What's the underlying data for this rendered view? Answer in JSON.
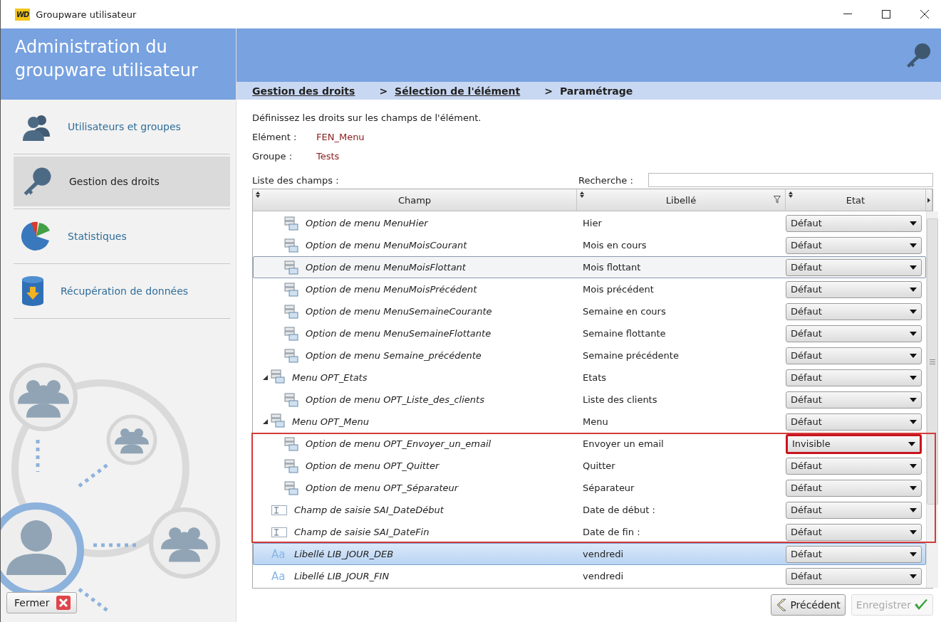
{
  "window": {
    "logo": "WD",
    "title": "Groupware utilisateur"
  },
  "sidebar": {
    "title_lines": [
      "Administration du",
      "groupware utilisateur"
    ],
    "items": [
      {
        "label": "Utilisateurs et groupes",
        "selected": false
      },
      {
        "label": "Gestion des droits",
        "selected": true
      },
      {
        "label": "Statistiques",
        "selected": false
      },
      {
        "label": "Récupération de données",
        "selected": false
      }
    ],
    "close_button": "Fermer"
  },
  "breadcrumb": [
    {
      "text": "Gestion des droits",
      "kind": "link"
    },
    {
      "text": ">",
      "kind": "separator"
    },
    {
      "text": "Sélection de l'élément",
      "kind": "link"
    },
    {
      "text": ">",
      "kind": "separator"
    },
    {
      "text": "Paramétrage",
      "kind": "current"
    }
  ],
  "intro": "Définissez les droits sur les champs de l'élément.",
  "fields": [
    {
      "label": "Elément :",
      "value": "FEN_Menu"
    },
    {
      "label": "Groupe :",
      "value": "Tests"
    }
  ],
  "list_label": "Liste des champs :",
  "search": {
    "label": "Recherche :"
  },
  "table": {
    "columns": [
      {
        "title": "Champ",
        "filter": false
      },
      {
        "title": "Libellé",
        "filter": true
      },
      {
        "title": "Etat",
        "filter": false
      }
    ],
    "rows": [
      {
        "kind": "menu-option",
        "name": "Option de menu MenuHier",
        "label": "Hier",
        "state": "Défaut",
        "selected": false,
        "focused": false,
        "highlighted": false,
        "state_marked": false
      },
      {
        "kind": "menu-option",
        "name": "Option de menu MenuMoisCourant",
        "label": "Mois en cours",
        "state": "Défaut",
        "selected": false,
        "focused": false,
        "highlighted": false,
        "state_marked": false
      },
      {
        "kind": "menu-option",
        "name": "Option de menu MenuMoisFlottant",
        "label": "Mois flottant",
        "state": "Défaut",
        "selected": false,
        "focused": true,
        "highlighted": false,
        "state_marked": false
      },
      {
        "kind": "menu-option",
        "name": "Option de menu MenuMoisPrécédent",
        "label": "Mois précédent",
        "state": "Défaut",
        "selected": false,
        "focused": false,
        "highlighted": false,
        "state_marked": false
      },
      {
        "kind": "menu-option",
        "name": "Option de menu MenuSemaineCourante",
        "label": "Semaine en cours",
        "state": "Défaut",
        "selected": false,
        "focused": false,
        "highlighted": false,
        "state_marked": false
      },
      {
        "kind": "menu-option",
        "name": "Option de menu MenuSemaineFlottante",
        "label": "Semaine flottante",
        "state": "Défaut",
        "selected": false,
        "focused": false,
        "highlighted": false,
        "state_marked": false
      },
      {
        "kind": "menu-option",
        "name": "Option de menu Semaine_précédente",
        "label": "Semaine précédente",
        "state": "Défaut",
        "selected": false,
        "focused": false,
        "highlighted": false,
        "state_marked": false
      },
      {
        "kind": "menu",
        "name": "Menu OPT_Etats",
        "label": "Etats",
        "state": "Défaut",
        "selected": false,
        "focused": false,
        "highlighted": false,
        "state_marked": false,
        "expanded": true,
        "children": [
          {
            "kind": "menu-option",
            "name": "Option de menu OPT_Liste_des_clients",
            "label": "Liste des clients",
            "state": "Défaut",
            "selected": false,
            "focused": false,
            "highlighted": false,
            "state_marked": false
          }
        ]
      },
      {
        "kind": "menu",
        "name": "Menu OPT_Menu",
        "label": "Menu",
        "state": "Défaut",
        "selected": false,
        "focused": false,
        "highlighted": false,
        "state_marked": false,
        "expanded": true,
        "children": [
          {
            "kind": "menu-option",
            "name": "Option de menu OPT_Envoyer_un_email",
            "label": "Envoyer un email",
            "state": "Invisible",
            "selected": false,
            "focused": false,
            "highlighted": true,
            "state_marked": true
          },
          {
            "kind": "menu-option",
            "name": "Option de menu OPT_Quitter",
            "label": "Quitter",
            "state": "Défaut",
            "selected": false,
            "focused": false,
            "highlighted": true,
            "state_marked": false
          },
          {
            "kind": "menu-option",
            "name": "Option de menu OPT_Séparateur",
            "label": "Séparateur",
            "state": "Défaut",
            "selected": false,
            "focused": false,
            "highlighted": true,
            "state_marked": false
          }
        ]
      },
      {
        "kind": "edit-field",
        "name": "Champ de saisie SAI_DateDébut",
        "label": "Date de début :",
        "state": "Défaut",
        "selected": false,
        "focused": false,
        "highlighted": true,
        "state_marked": false
      },
      {
        "kind": "edit-field",
        "name": "Champ de saisie SAI_DateFin",
        "label": "Date de fin :",
        "state": "Défaut",
        "selected": false,
        "focused": false,
        "highlighted": true,
        "state_marked": false
      },
      {
        "kind": "text-label",
        "icon_text": "Aa",
        "name": "Libellé LIB_JOUR_DEB",
        "label": "vendredi",
        "state": "Défaut",
        "selected": true,
        "focused": false,
        "highlighted": false,
        "state_marked": false
      },
      {
        "kind": "text-label",
        "icon_text": "Aa",
        "name": "Libellé LIB_JOUR_FIN",
        "label": "vendredi",
        "state": "Défaut",
        "selected": false,
        "focused": false,
        "highlighted": false,
        "state_marked": false
      }
    ]
  },
  "buttons": [
    {
      "label": "Précédent",
      "kind": "back",
      "disabled": false
    },
    {
      "label": "Enregistrer",
      "kind": "save",
      "disabled": true
    }
  ]
}
